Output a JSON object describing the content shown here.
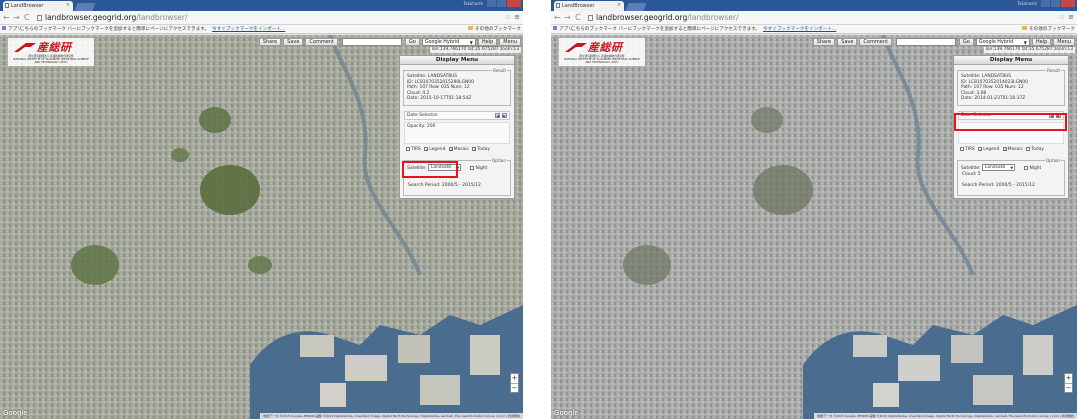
{
  "colors": {
    "highlight": "#e8141b",
    "accent_brand": "#c8161d",
    "water": "#4a6d8f",
    "map_base": "#9ca194"
  },
  "browser": {
    "tab_title": "LandBrowser",
    "url_host": "landbrowser.geogrid.org",
    "url_path": "/landbrowser/",
    "apps_label": "アプリ",
    "bookmarks_prompt": "こちらのブックマーク バーにブックマークを追加すると簡単にページにアクセスできます。",
    "import_link": "今すぐブックマークをインポート...",
    "other_bookmarks": "その他のブックマーク",
    "window_user_label": "Takahashi"
  },
  "app": {
    "logo_text": "産総研",
    "logo_sub_jp": "国立研究開発法人 産業技術総合研究所",
    "logo_sub_en": "NATIONAL INSTITUTE OF ADVANCED INDUSTRIAL SCIENCE AND TECHNOLOGY (AIST)",
    "toolbar": {
      "share": "Share",
      "save": "Save",
      "comment": "Comment",
      "go": "Go",
      "map_type": "Google Hybrid",
      "help": "Help",
      "menu": "Menu"
    },
    "coords": "lon:139.766170 lat:35.675287 zoom:13"
  },
  "panels": [
    {
      "menu": {
        "title": "Display Menu",
        "result_legend": "Result",
        "satellite_line": "Satellite: LANDSAT8US",
        "id_line": "ID: LC81070352015290LGN00",
        "path_line": "Path: 107 Row: 035 Num: 12",
        "cloud_line": "Cloud: 4.2",
        "date_line": "Date: 2015-10-17T01:18:54Z",
        "date_selector": "Date Selector",
        "opacity": "Opacity: 200",
        "check_tiles": "TIRS",
        "check_legend": "Legend",
        "check_mosaic": "Mosaic",
        "check_today": "Today",
        "option_legend": "Option",
        "satellite_label": "Satellite:",
        "satellite_value": "Landsat8",
        "night_label": "Night",
        "cloud_option": "",
        "search_period": "Search Period:  2000/5 - 2015/12"
      }
    },
    {
      "menu": {
        "title": "Display Menu",
        "result_legend": "Result",
        "satellite_line": "Satellite: LANDSAT8US",
        "id_line": "ID: LC81070352014023LGN00",
        "path_line": "Path: 107 Row: 035 Num: 12",
        "cloud_line": "Cloud: 3.08",
        "date_line": "Date: 2014-01-23T01:16:37Z",
        "date_selector": "Date Selector",
        "opacity": "",
        "check_tiles": "TIRS",
        "check_legend": "Legend",
        "check_mosaic": "Mosaic",
        "check_today": "Today",
        "option_legend": "Option",
        "satellite_label": "Satellite:",
        "satellite_value": "Landsat8",
        "night_label": "Night",
        "cloud_option": "Cloud: 5",
        "search_period": "Search Period:  2000/5 - 2015/12"
      }
    }
  ],
  "map": {
    "google_logo": "Google",
    "attribution": "地図データ ©2015 Google, ZENRIN 画像 ©2015 DigitalGlobe, Cnes/Spot Image, Digital Earth Technology, DigitalGlobe, Landsat, The GeoInformation Group | 1 km | 利用規約",
    "zoom_in": "+",
    "zoom_out": "−"
  }
}
